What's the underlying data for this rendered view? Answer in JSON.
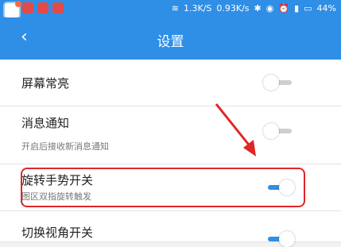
{
  "status_bar": {
    "network_speed": "1.3K/S",
    "download_speed": "0.93K/s",
    "battery": "44%"
  },
  "header": {
    "back_glyph": "‹",
    "title": "设置"
  },
  "settings": [
    {
      "label": "屏幕常亮",
      "sub": "",
      "enabled": false
    },
    {
      "label": "消息通知",
      "sub": "开启后接收新消息通知",
      "enabled": false
    },
    {
      "label": "旋转手势开关",
      "sub": "图区双指旋转触发",
      "enabled": true
    },
    {
      "label": "切换视角开关",
      "sub": "",
      "enabled": true
    }
  ],
  "colors": {
    "accent": "#2f8ee6",
    "annotation_red": "#e02626"
  }
}
